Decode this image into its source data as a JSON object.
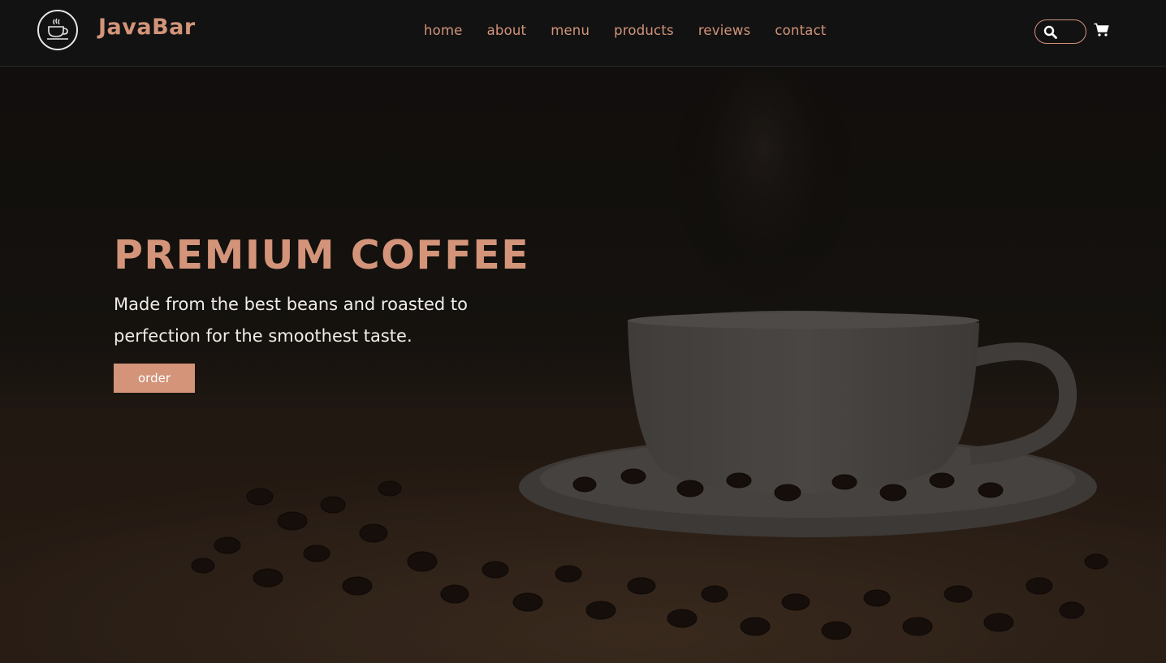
{
  "header": {
    "brand": "JavaBar",
    "logo_icon": "coffee-cup-icon",
    "nav": [
      "home",
      "about",
      "menu",
      "products",
      "reviews",
      "contact"
    ],
    "search_icon": "search-icon",
    "cart_icon": "cart-icon"
  },
  "hero": {
    "title": "PREMIUM COFFEE",
    "subtitle": "Made from the best beans and roasted to perfection for the smoothest taste.",
    "button_label": "order",
    "background": "coffee-cup-with-beans-photo"
  },
  "colors": {
    "accent": "#d3947a",
    "header_bg": "#121212",
    "text_light": "#f0ece8"
  }
}
